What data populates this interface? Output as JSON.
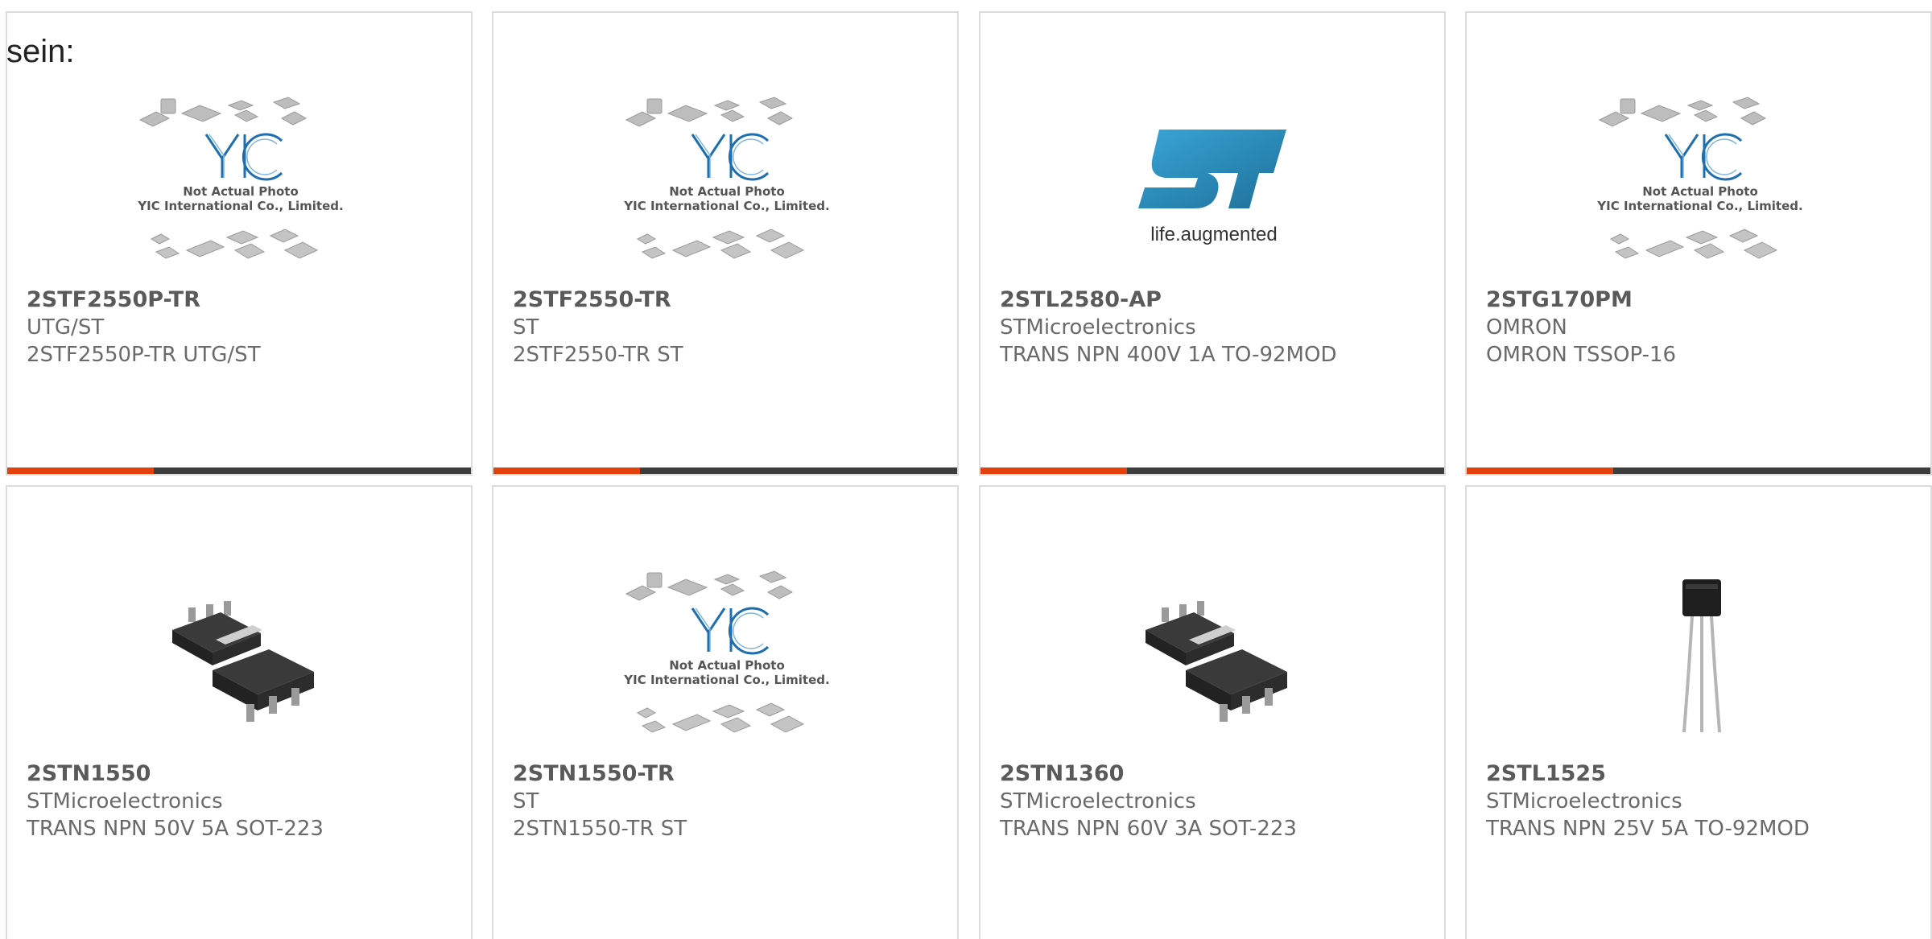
{
  "lead_text": "sein:",
  "colors": {
    "accent": "#e3410b",
    "bar": "#3d3d3d",
    "card_border": "#dcdcdc",
    "st_blue": "#2f8fbd"
  },
  "placeholder": {
    "logo": "YIC",
    "line1": "Not Actual Photo",
    "line2": "YIC International Co., Limited."
  },
  "st_logo": {
    "tagline": "life.augmented"
  },
  "products": [
    {
      "part": "2STF2550P-TR",
      "maker": "UTG/ST",
      "desc": "2STF2550P-TR UTG/ST",
      "image": "placeholder"
    },
    {
      "part": "2STF2550-TR",
      "maker": "ST",
      "desc": "2STF2550-TR ST",
      "image": "placeholder"
    },
    {
      "part": "2STL2580-AP",
      "maker": "STMicroelectronics",
      "desc": "TRANS NPN 400V 1A TO-92MOD",
      "image": "st-logo"
    },
    {
      "part": "2STG170PM",
      "maker": "OMRON",
      "desc": "OMRON TSSOP-16",
      "image": "placeholder"
    },
    {
      "part": "2STN1550",
      "maker": "STMicroelectronics",
      "desc": "TRANS NPN 50V 5A SOT-223",
      "image": "sot223"
    },
    {
      "part": "2STN1550-TR",
      "maker": "ST",
      "desc": "2STN1550-TR ST",
      "image": "placeholder"
    },
    {
      "part": "2STN1360",
      "maker": "STMicroelectronics",
      "desc": "TRANS NPN 60V 3A SOT-223",
      "image": "sot223"
    },
    {
      "part": "2STL1525",
      "maker": "STMicroelectronics",
      "desc": "TRANS NPN 25V 5A TO-92MOD",
      "image": "to92"
    }
  ]
}
